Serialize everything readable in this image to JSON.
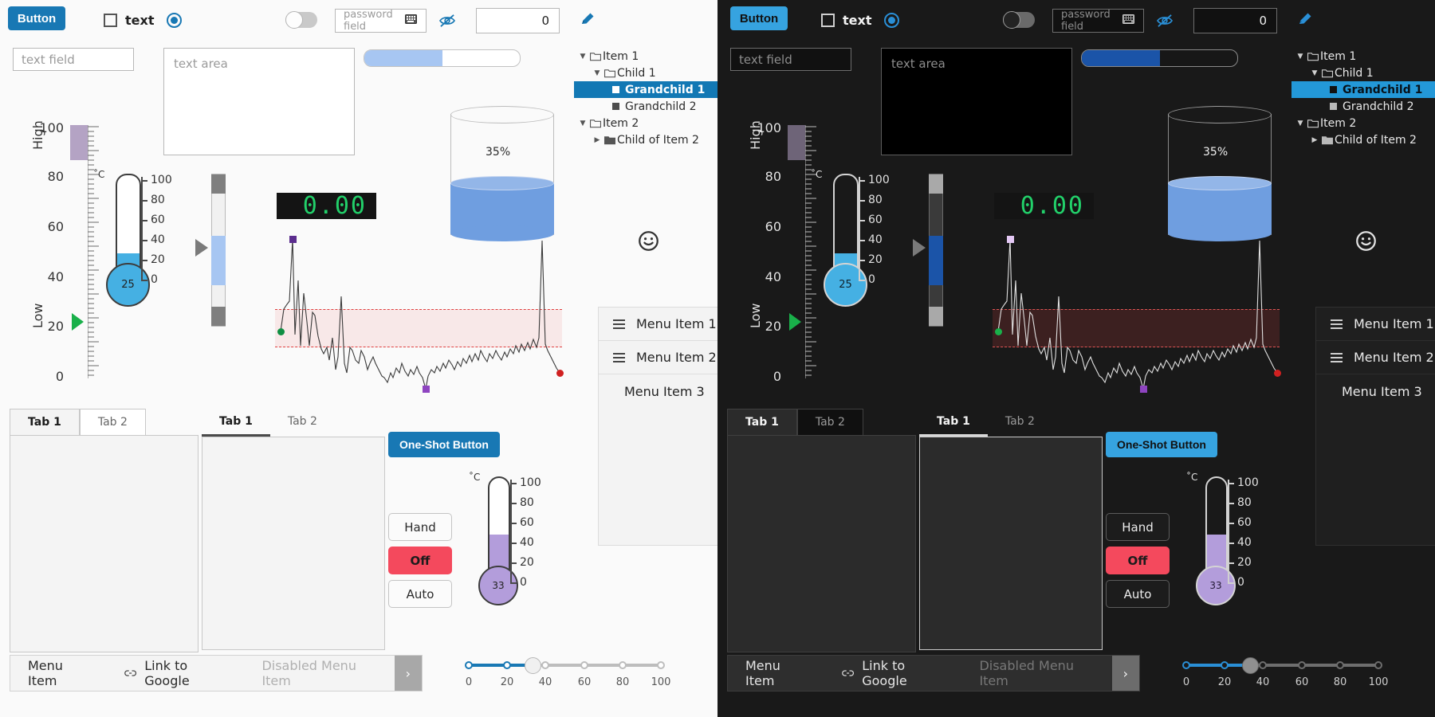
{
  "theme_colors": {
    "light_bg": "#fafafa",
    "dark_bg": "#191919",
    "accent_light": "#1878b4",
    "accent_dark": "#36a3e0",
    "selection_light": "#1278b4",
    "selection_dark": "#2398d8",
    "off_red": "#f4495d",
    "lcd_green": "#22d06a",
    "liquid_blue": "#6f9ee0",
    "mercury_blue": "#45b0e3",
    "mercury_purple": "#b39ddb",
    "alarm_band": "#e04040"
  },
  "toolbar": {
    "button_label": "Button",
    "checkbox_label": "text",
    "checkbox_checked": false,
    "radio_checked": true,
    "switch_on": false,
    "password_placeholder": "password field",
    "password_reveal_icon": "eye-off-icon",
    "password_keyboard_icon": "keyboard-icon",
    "spinbox_value": "0",
    "edit_icon": "pencil-icon"
  },
  "inputs": {
    "text_field_placeholder": "text field",
    "text_area_placeholder": "text area"
  },
  "progress": {
    "percent": 50
  },
  "tree": {
    "items": [
      {
        "label": "Item 1",
        "depth": 0,
        "arrow": "down",
        "icon": "folder-open-icon",
        "selected": false
      },
      {
        "label": "Child 1",
        "depth": 1,
        "arrow": "down",
        "icon": "folder-open-icon",
        "selected": false
      },
      {
        "label": "Grandchild 1",
        "depth": 2,
        "arrow": "none",
        "icon": "leaf-square-white-icon",
        "selected": true
      },
      {
        "label": "Grandchild 2",
        "depth": 2,
        "arrow": "none",
        "icon": "leaf-square-gray-icon",
        "selected": false
      },
      {
        "label": "Item 2",
        "depth": 0,
        "arrow": "down",
        "icon": "folder-open-icon",
        "selected": false
      },
      {
        "label": "Child of Item 2",
        "depth": 1,
        "arrow": "right",
        "icon": "folder-closed-icon",
        "selected": false
      }
    ]
  },
  "scale_gauge": {
    "ticks": [
      "100",
      "80",
      "60",
      "40",
      "20",
      "0"
    ],
    "label_high": "High",
    "label_low": "Low",
    "value": 20,
    "high_band_from": 85,
    "high_band_to": 100,
    "marker_icon": "green-arrow-marker"
  },
  "thermometer_main": {
    "unit": "˚C",
    "ticks": [
      "100",
      "80",
      "60",
      "40",
      "20",
      "0"
    ],
    "value": "25",
    "fill_color": "#45b0e3"
  },
  "thermometer_small": {
    "unit": "˚C",
    "ticks": [
      "100",
      "80",
      "60",
      "40",
      "20",
      "0"
    ],
    "value": "33",
    "fill_color": "#b39ddb"
  },
  "vertical_slider": {
    "value": 45,
    "range_from": 35,
    "range_to": 58,
    "marker_icon": "gray-arrow-marker"
  },
  "lcd": {
    "value": "0.00"
  },
  "tank": {
    "percent_label": "35%",
    "percent": 35
  },
  "smiley": {
    "icon": "smiley-face-icon"
  },
  "chart_data": {
    "type": "line",
    "title": "",
    "xlabel": "",
    "ylabel": "",
    "grid": false,
    "legend": "none",
    "alarm_band": {
      "low": 22,
      "high": 52,
      "color": "#e04040"
    },
    "markers": [
      {
        "name": "start-point",
        "x": 2,
        "y": 38,
        "color": "#0f8f43",
        "shape": "circle"
      },
      {
        "name": "max-point",
        "x": 5,
        "y": 96,
        "color": "#5b2d8e",
        "shape": "square"
      },
      {
        "name": "min-point",
        "x": 50,
        "y": 2,
        "color": "#8e44c0",
        "shape": "square"
      },
      {
        "name": "end-point",
        "x": 99,
        "y": 8,
        "color": "#d02020",
        "shape": "circle"
      }
    ],
    "y": [
      38,
      52,
      55,
      57,
      96,
      36,
      70,
      29,
      62,
      44,
      29,
      50,
      48,
      35,
      27,
      24,
      28,
      20,
      34,
      14,
      22,
      60,
      18,
      12,
      28,
      26,
      20,
      18,
      26,
      22,
      14,
      18,
      22,
      18,
      14,
      10,
      9,
      6,
      12,
      9,
      15,
      12,
      18,
      13,
      10,
      14,
      11,
      16,
      12,
      9,
      2,
      10,
      14,
      12,
      16,
      13,
      18,
      15,
      20,
      17,
      14,
      19,
      16,
      21,
      18,
      23,
      19,
      24,
      20,
      26,
      22,
      19,
      24,
      21,
      26,
      23,
      20,
      25,
      22,
      27,
      24,
      29,
      25,
      30,
      26,
      31,
      27,
      33,
      28,
      34,
      29,
      95,
      30,
      26,
      22,
      18,
      15,
      12,
      10,
      8
    ],
    "ylim": [
      0,
      100
    ],
    "xlim": [
      0,
      99
    ]
  },
  "menu_list": {
    "items": [
      {
        "label": "Menu Item 1",
        "icon": "list-icon"
      },
      {
        "label": "Menu Item 2",
        "icon": "list-icon"
      },
      {
        "label": "Menu Item 3",
        "icon": "none"
      }
    ]
  },
  "tabs_left": {
    "tabs": [
      {
        "label": "Tab 1",
        "active": true
      },
      {
        "label": "Tab 2",
        "active": false
      }
    ]
  },
  "tabs_right": {
    "tabs": [
      {
        "label": "Tab 1",
        "active": true
      },
      {
        "label": "Tab 2",
        "active": false
      }
    ]
  },
  "one_shot": {
    "label": "One-Shot Button"
  },
  "mode_buttons": {
    "hand": "Hand",
    "off": "Off",
    "auto": "Auto",
    "active": "Off"
  },
  "menubar": {
    "items": [
      {
        "label": "Menu Item",
        "icon": "none",
        "disabled": false
      },
      {
        "label": "Link to Google",
        "icon": "link-icon",
        "disabled": false
      },
      {
        "label": "Disabled Menu Item",
        "icon": "none",
        "disabled": true
      }
    ],
    "more_icon": "chevron-right-icon"
  },
  "hslider": {
    "ticks": [
      "0",
      "20",
      "40",
      "60",
      "80",
      "100"
    ],
    "value": 33
  }
}
